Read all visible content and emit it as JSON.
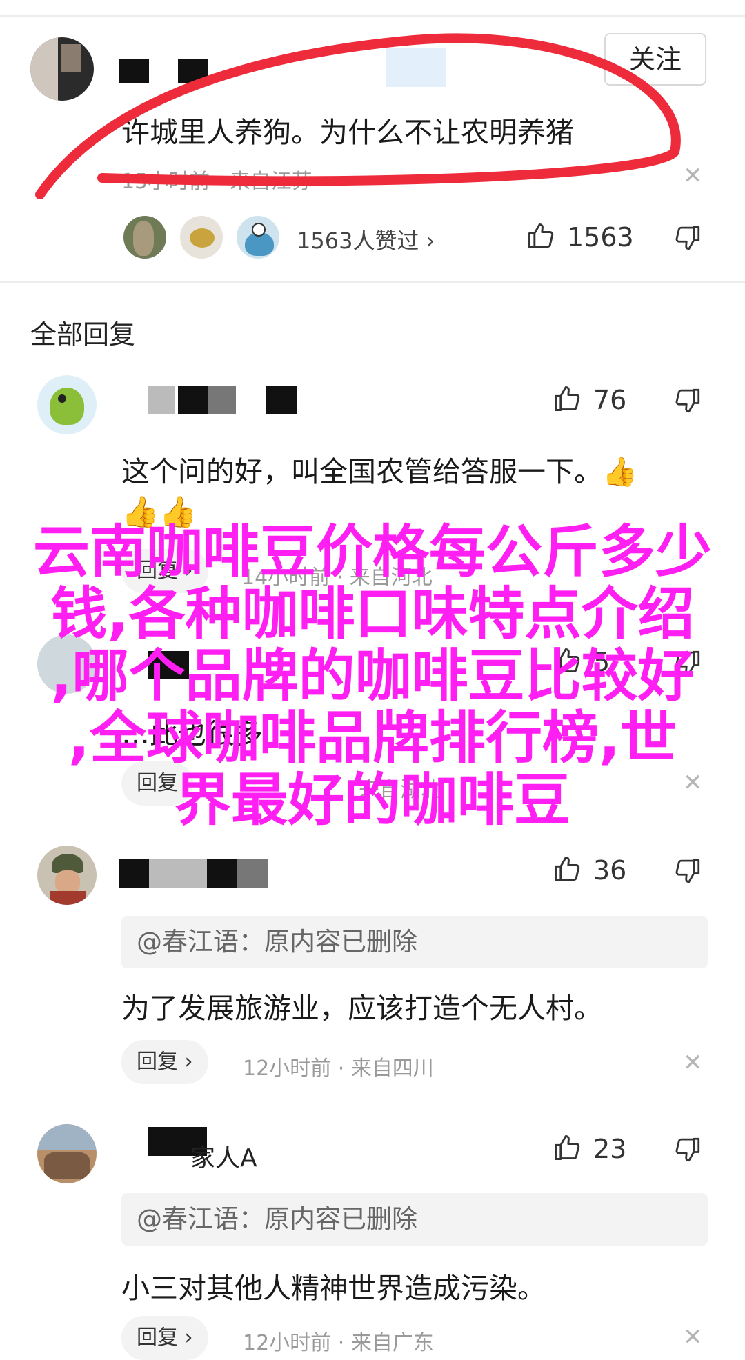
{
  "header_comment": {
    "follow_label": "关注",
    "text": "许城里人养狗。为什么不让农明养猪",
    "time": "15小时前",
    "location": "来自江苏",
    "likers_label": "1563人赞过 ›",
    "like_count": "1563"
  },
  "section_title": "全部回复",
  "replies": [
    {
      "like_count": "76",
      "text_line1": "这个问的好，叫全国农管给答服一下。",
      "reply_label": "回复 ›",
      "partial_meta": "14小时前 · 来自河北"
    },
    {
      "like_count": "5",
      "partial_text": "…此也很多",
      "reply_label": "回复",
      "partial_meta": "来自湖北"
    },
    {
      "like_count": "36",
      "quote": "@春江语：原内容已删除",
      "text": "为了发展旅游业，应该打造个无人村。",
      "reply_label": "回复 ›",
      "time": "12小时前",
      "location": "来自四川"
    },
    {
      "name": "家人A",
      "like_count": "23",
      "quote": "@春江语：原内容已删除",
      "text": "小三对其他人精神世界造成污染。",
      "reply_label": "回复 ›",
      "time": "12小时前",
      "location": "来自广东"
    }
  ],
  "overlay_text": [
    "云南咖啡豆价格每公斤多少",
    "钱,各种咖啡口味特点介绍",
    ",哪个品牌的咖啡豆比较好",
    ",全球咖啡品牌排行榜,世",
    "界最好的咖啡豆"
  ],
  "colors": {
    "overlay": "#ff1ff2",
    "annotation_circle": "#ee2b3b",
    "meta_gray": "#9a9a9a"
  },
  "icons": [
    "thumbs-up-icon",
    "thumbs-down-icon",
    "close-icon",
    "thumbs-up-emoji"
  ]
}
